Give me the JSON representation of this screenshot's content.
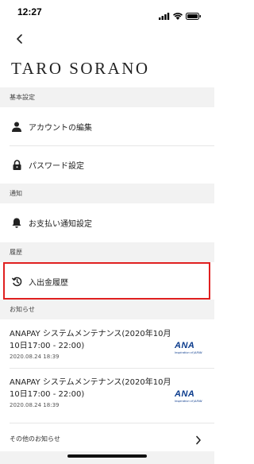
{
  "status_bar": {
    "time": "12:27"
  },
  "header": {
    "user_name": "TARO SORANO"
  },
  "sections": {
    "basic": {
      "title": "基本設定",
      "items": [
        {
          "label": "アカウントの編集",
          "icon": "person-icon"
        },
        {
          "label": "パスワード設定",
          "icon": "lock-icon"
        }
      ]
    },
    "notifications": {
      "title": "通知",
      "items": [
        {
          "label": "お支払い通知設定",
          "icon": "bell-icon"
        }
      ]
    },
    "history": {
      "title": "履歴",
      "items": [
        {
          "label": "入出金履歴",
          "icon": "history-icon"
        }
      ]
    },
    "news": {
      "title": "お知らせ",
      "items": [
        {
          "title": "ANAPAY システムメンテナンス(2020年10月10日17:00 - 22:00)",
          "date": "2020.08.24 18:39",
          "logo": "ANA",
          "logo_sub": "Inspiration of JAPAN"
        },
        {
          "title": "ANAPAY システムメンテナンス(2020年10月10日17:00 - 22:00)",
          "date": "2020.08.24 18:39",
          "logo": "ANA",
          "logo_sub": "Inspiration of JAPAN"
        }
      ],
      "more_label": "その他のお知らせ"
    }
  },
  "colors": {
    "highlight": "#e02020",
    "section_bg": "#f2f2f2",
    "ana_blue": "#0b3b8c"
  }
}
